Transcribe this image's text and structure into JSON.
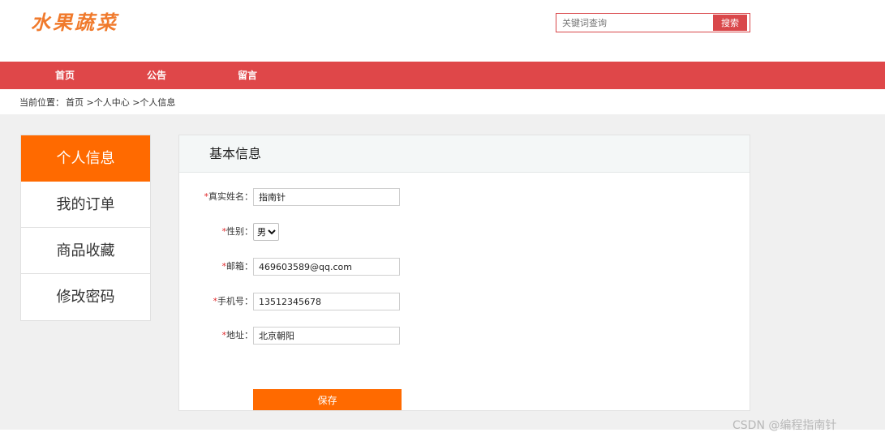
{
  "header": {
    "logo_text": "水果蔬菜",
    "search_placeholder": "关键词查询",
    "search_button": "搜索"
  },
  "nav": {
    "items": [
      {
        "label": "首页"
      },
      {
        "label": "公告"
      },
      {
        "label": "留言"
      }
    ]
  },
  "breadcrumb": {
    "prefix": "当前位置：",
    "path": "首页 >个人中心 >个人信息"
  },
  "sidebar": {
    "items": [
      {
        "label": "个人信息",
        "active": true
      },
      {
        "label": "我的订单",
        "active": false
      },
      {
        "label": "商品收藏",
        "active": false
      },
      {
        "label": "修改密码",
        "active": false
      }
    ]
  },
  "panel": {
    "title": "基本信息",
    "required_mark": "*",
    "fields": {
      "name": {
        "label": "真实姓名：",
        "value": "指南针"
      },
      "gender": {
        "label": "性别：",
        "value": "男",
        "options": [
          "男"
        ]
      },
      "email": {
        "label": "邮箱：",
        "value": "469603589@qq.com"
      },
      "phone": {
        "label": "手机号：",
        "value": "13512345678"
      },
      "address": {
        "label": "地址：",
        "value": "北京朝阳"
      }
    },
    "save_button": "保存"
  },
  "watermark": "CSDN @编程指南针",
  "colors": {
    "nav_red": "#df4749",
    "accent_orange": "#ff6a00",
    "logo_orange": "#f07a2c"
  }
}
